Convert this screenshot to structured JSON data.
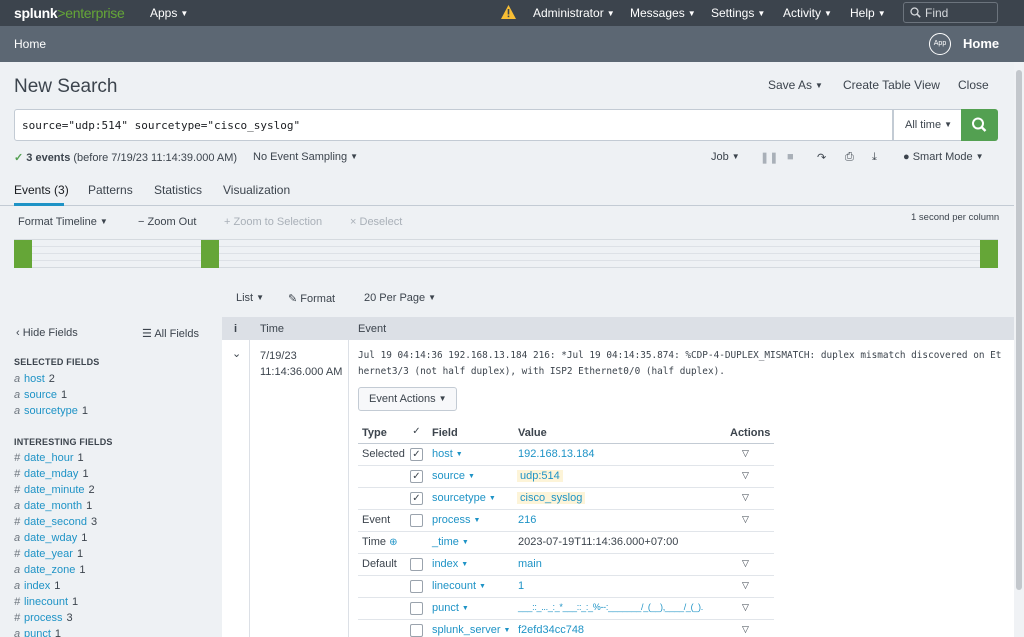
{
  "topnav": {
    "logo_main": "splunk",
    "logo_sep": ">",
    "logo_product": "enterprise",
    "apps": "Apps",
    "administrator": "Administrator",
    "messages": "Messages",
    "settings": "Settings",
    "activity": "Activity",
    "help": "Help",
    "find_placeholder": "Find"
  },
  "appbar": {
    "home_link": "Home",
    "app_icon": "App",
    "home_title": "Home"
  },
  "search": {
    "title": "New Search",
    "save_as": "Save As",
    "create_table_view": "Create Table View",
    "close": "Close",
    "query": "source=\"udp:514\" sourcetype=\"cisco_syslog\"",
    "time_range": "All time",
    "events_count": "3 events",
    "events_before": "(before 7/19/23 11:14:39.000 AM)",
    "sampling": "No Event Sampling",
    "job": "Job",
    "mode": "Smart Mode"
  },
  "tabs": [
    "Events (3)",
    "Patterns",
    "Statistics",
    "Visualization"
  ],
  "timeline": {
    "format_timeline": "Format Timeline",
    "zoom_out": "Zoom Out",
    "zoom_selection": "Zoom to Selection",
    "deselect": "Deselect",
    "scale": "1 second per column"
  },
  "results_toolbar": {
    "list": "List",
    "format": "Format",
    "per_page": "20 Per Page"
  },
  "fields_panel": {
    "hide_fields": "Hide Fields",
    "all_fields": "All Fields",
    "selected_heading": "SELECTED FIELDS",
    "selected": [
      {
        "type": "a",
        "name": "host",
        "count": "2"
      },
      {
        "type": "a",
        "name": "source",
        "count": "1"
      },
      {
        "type": "a",
        "name": "sourcetype",
        "count": "1"
      }
    ],
    "interesting_heading": "INTERESTING FIELDS",
    "interesting": [
      {
        "type": "#",
        "name": "date_hour",
        "count": "1"
      },
      {
        "type": "#",
        "name": "date_mday",
        "count": "1"
      },
      {
        "type": "#",
        "name": "date_minute",
        "count": "2"
      },
      {
        "type": "a",
        "name": "date_month",
        "count": "1"
      },
      {
        "type": "#",
        "name": "date_second",
        "count": "3"
      },
      {
        "type": "a",
        "name": "date_wday",
        "count": "1"
      },
      {
        "type": "#",
        "name": "date_year",
        "count": "1"
      },
      {
        "type": "a",
        "name": "date_zone",
        "count": "1"
      },
      {
        "type": "a",
        "name": "index",
        "count": "1"
      },
      {
        "type": "#",
        "name": "linecount",
        "count": "1"
      },
      {
        "type": "#",
        "name": "process",
        "count": "3"
      },
      {
        "type": "a",
        "name": "punct",
        "count": "1"
      }
    ]
  },
  "results": {
    "col_info": "i",
    "col_time": "Time",
    "col_event": "Event",
    "event_date": "7/19/23",
    "event_time": "11:14:36.000 AM",
    "event_raw": "Jul 19 04:14:36 192.168.13.184 216: *Jul 19 04:14:35.874: %CDP-4-DUPLEX_MISMATCH: duplex mismatch discovered on Ethernet3/3 (not half duplex), with ISP2 Ethernet0/0 (half duplex).",
    "event_actions": "Event Actions",
    "field_table": {
      "h_type": "Type",
      "h_field": "Field",
      "h_value": "Value",
      "h_actions": "Actions",
      "rows": [
        {
          "type": "Selected",
          "field": "host",
          "value": "192.168.13.184"
        },
        {
          "type": "",
          "field": "source",
          "value": "udp:514"
        },
        {
          "type": "",
          "field": "sourcetype",
          "value": "cisco_syslog"
        },
        {
          "type": "Event",
          "field": "process",
          "value": "216"
        },
        {
          "type": "Time",
          "field": "_time",
          "value": "2023-07-19T11:14:36.000+07:00"
        },
        {
          "type": "Default",
          "field": "index",
          "value": "main"
        },
        {
          "type": "",
          "field": "linecount",
          "value": "1"
        },
        {
          "type": "",
          "field": "punct",
          "value": "___::_..._:_*___::_:_%--:_______/_(__),____/_(_)."
        },
        {
          "type": "",
          "field": "splunk_server",
          "value": "f2efd34cc748"
        }
      ]
    }
  },
  "colors": {
    "topnav_bg": "#3c444d",
    "appbar_bg": "#5c6773",
    "accent_green": "#53a051",
    "timeline_green": "#65a637",
    "link_blue": "#1e93c6",
    "warning_yellow": "#f8be34"
  }
}
